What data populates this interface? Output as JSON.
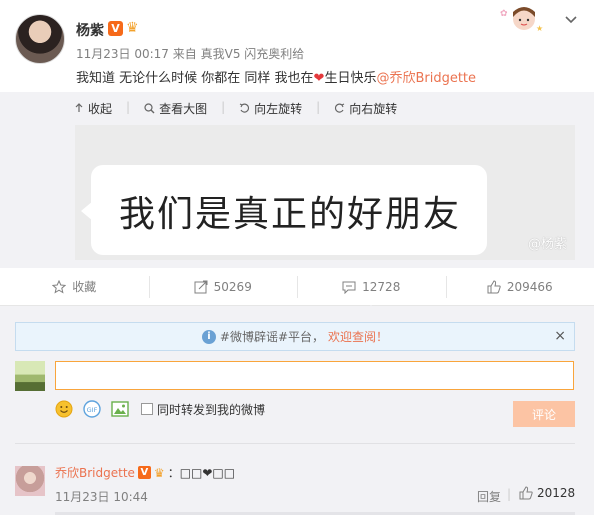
{
  "post": {
    "user_name": "杨紫",
    "v_badge": "V",
    "crown_badge": "♛",
    "time": "11月23日 00:17",
    "source_prefix": "来自",
    "source": "真我V5 闪充奥利给",
    "text_before": "我知道 无论什么时候 你都在 同样 我也在",
    "heart": "❤",
    "text_after": "生日快乐",
    "mention": "@乔欣Bridgette"
  },
  "media": {
    "toolbar": [
      {
        "icon": "collapse-icon",
        "label": "收起"
      },
      {
        "icon": "zoom-icon",
        "label": "查看大图"
      },
      {
        "icon": "rotate-left-icon",
        "label": "向左旋转"
      },
      {
        "icon": "rotate-right-icon",
        "label": "向右旋转"
      }
    ],
    "image_text": "我们是真正的好朋友",
    "watermark": "@杨紫"
  },
  "actions": {
    "favorite": "收藏",
    "forward": "50269",
    "comment": "12728",
    "like": "209466"
  },
  "comment_box": {
    "notice_prefix": "#微博辟谣#平台，",
    "notice_highlight": "欢迎查阅！",
    "notice_close": "×",
    "input_value": "",
    "forward_label": "同时转发到我的微博",
    "submit_label": "评论"
  },
  "comments": [
    {
      "name": "乔欣Bridgette",
      "v_badge": "V",
      "crown_badge": "♛",
      "text": "：□□❤□□",
      "time": "11月23日 10:44",
      "reply_label": "回复",
      "likes": "20128"
    }
  ],
  "colors": {
    "accent_orange": "#eb7350",
    "badge_orange": "#f66a1a",
    "submit_disabled": "#fcc4a4",
    "input_border": "#f9a53c"
  }
}
